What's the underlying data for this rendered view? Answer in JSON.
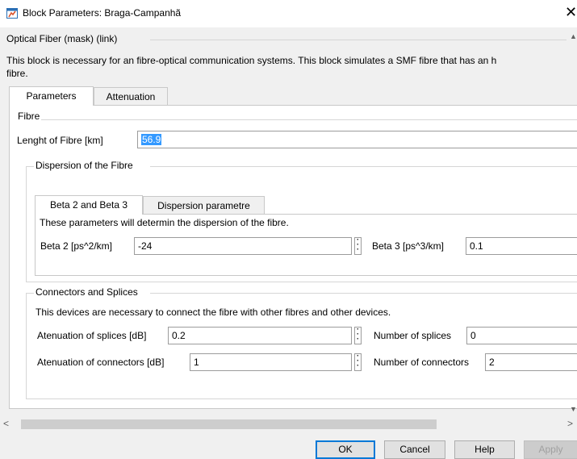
{
  "window": {
    "title": "Block Parameters: Braga-Campanhã",
    "app_icon": "simulink-block-icon",
    "close_icon": "close-icon"
  },
  "mask": {
    "header": "Optical Fiber (mask) (link)",
    "description_line1": "This block is necessary for an fibre-optical communication systems. This block simulates a SMF fibre that has an h",
    "description_line2": "fibre."
  },
  "tabs": [
    {
      "label": "Parameters",
      "active": true
    },
    {
      "label": "Attenuation",
      "active": false
    }
  ],
  "fibre": {
    "group_title": "Fibre",
    "length_label": "Lenght of Fibre [km]",
    "length_value": "56.9"
  },
  "dispersion": {
    "group_title": "Dispersion of the Fibre",
    "tabs": [
      {
        "label": "Beta 2 and Beta 3",
        "active": true
      },
      {
        "label": "Dispersion parametre",
        "active": false
      }
    ],
    "description": "These parameters will determin the dispersion of the fibre.",
    "beta2_label": "Beta 2 [ps^2/km]",
    "beta2_value": "-24",
    "beta3_label": "Beta 3 [ps^3/km]",
    "beta3_value": "0.1"
  },
  "connectors": {
    "group_title": "Connectors and Splices",
    "description": "This devices are necessary to connect the fibre with other fibres and other devices.",
    "splice_att_label": "Atenuation of splices [dB]",
    "splice_att_value": "0.2",
    "num_splices_label": "Number of splices",
    "num_splices_value": "0",
    "conn_att_label": "Atenuation of connectors [dB]",
    "conn_att_value": "1",
    "num_connectors_label": "Number of connectors",
    "num_connectors_value": "2"
  },
  "buttons": {
    "ok": "OK",
    "cancel": "Cancel",
    "help": "Help",
    "apply": "Apply"
  },
  "scroll": {
    "left_arrow": "<",
    "right_arrow": ">"
  },
  "colors": {
    "selection": "#3399ff",
    "default_button_border": "#0078d7"
  }
}
